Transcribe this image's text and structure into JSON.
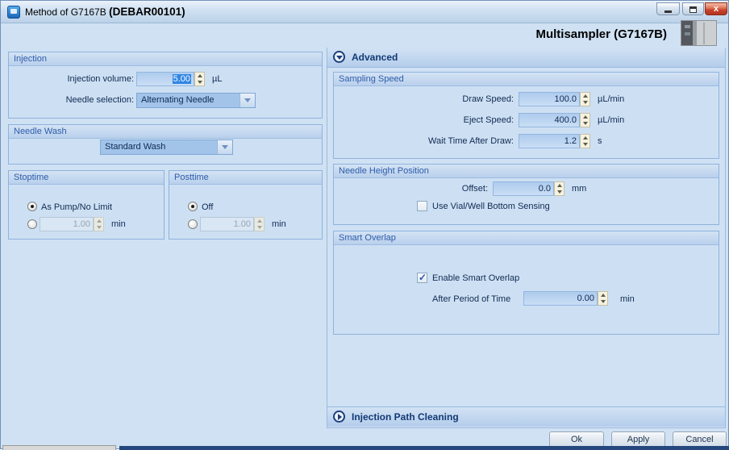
{
  "window": {
    "title_prefix": "Method of G7167B ",
    "title_suffix": "(DEBAR00101)",
    "close_glyph": "x",
    "header_title": "Multisampler (G7167B)"
  },
  "injection": {
    "title": "Injection",
    "volume_label": "Injection volume:",
    "volume_value": "5.00",
    "volume_unit": "µL",
    "needle_label": "Needle selection:",
    "needle_value": "Alternating Needle"
  },
  "needle_wash": {
    "title": "Needle Wash",
    "value": "Standard Wash"
  },
  "stoptime": {
    "title": "Stoptime",
    "option1": "As Pump/No Limit",
    "time_value": "1.00",
    "time_unit": "min"
  },
  "posttime": {
    "title": "Posttime",
    "option1": "Off",
    "time_value": "1.00",
    "time_unit": "min"
  },
  "advanced": {
    "title": "Advanced",
    "sampling_speed": {
      "title": "Sampling Speed",
      "rows": [
        {
          "label": "Draw Speed:",
          "value": "100.0",
          "unit": "µL/min"
        },
        {
          "label": "Eject Speed:",
          "value": "400.0",
          "unit": "µL/min"
        },
        {
          "label": "Wait Time After Draw:",
          "value": "1.2",
          "unit": "s"
        }
      ]
    },
    "needle_height": {
      "title": "Needle Height Position",
      "offset_label": "Offset:",
      "offset_value": "0.0",
      "offset_unit": "mm",
      "checkbox_label": "Use Vial/Well Bottom Sensing"
    },
    "smart_overlap": {
      "title": "Smart Overlap",
      "enable_label": "Enable Smart Overlap",
      "period_label": "After Period of Time",
      "period_value": "0.00",
      "period_unit": "min"
    }
  },
  "injection_path_cleaning": {
    "title": "Injection Path Cleaning"
  },
  "buttons": {
    "ok": "Ok",
    "apply": "Apply",
    "cancel": "Cancel"
  },
  "colors": {
    "accent_selection": "#3086e4",
    "band_text": "#123a75",
    "close_button": "#c8422c"
  }
}
